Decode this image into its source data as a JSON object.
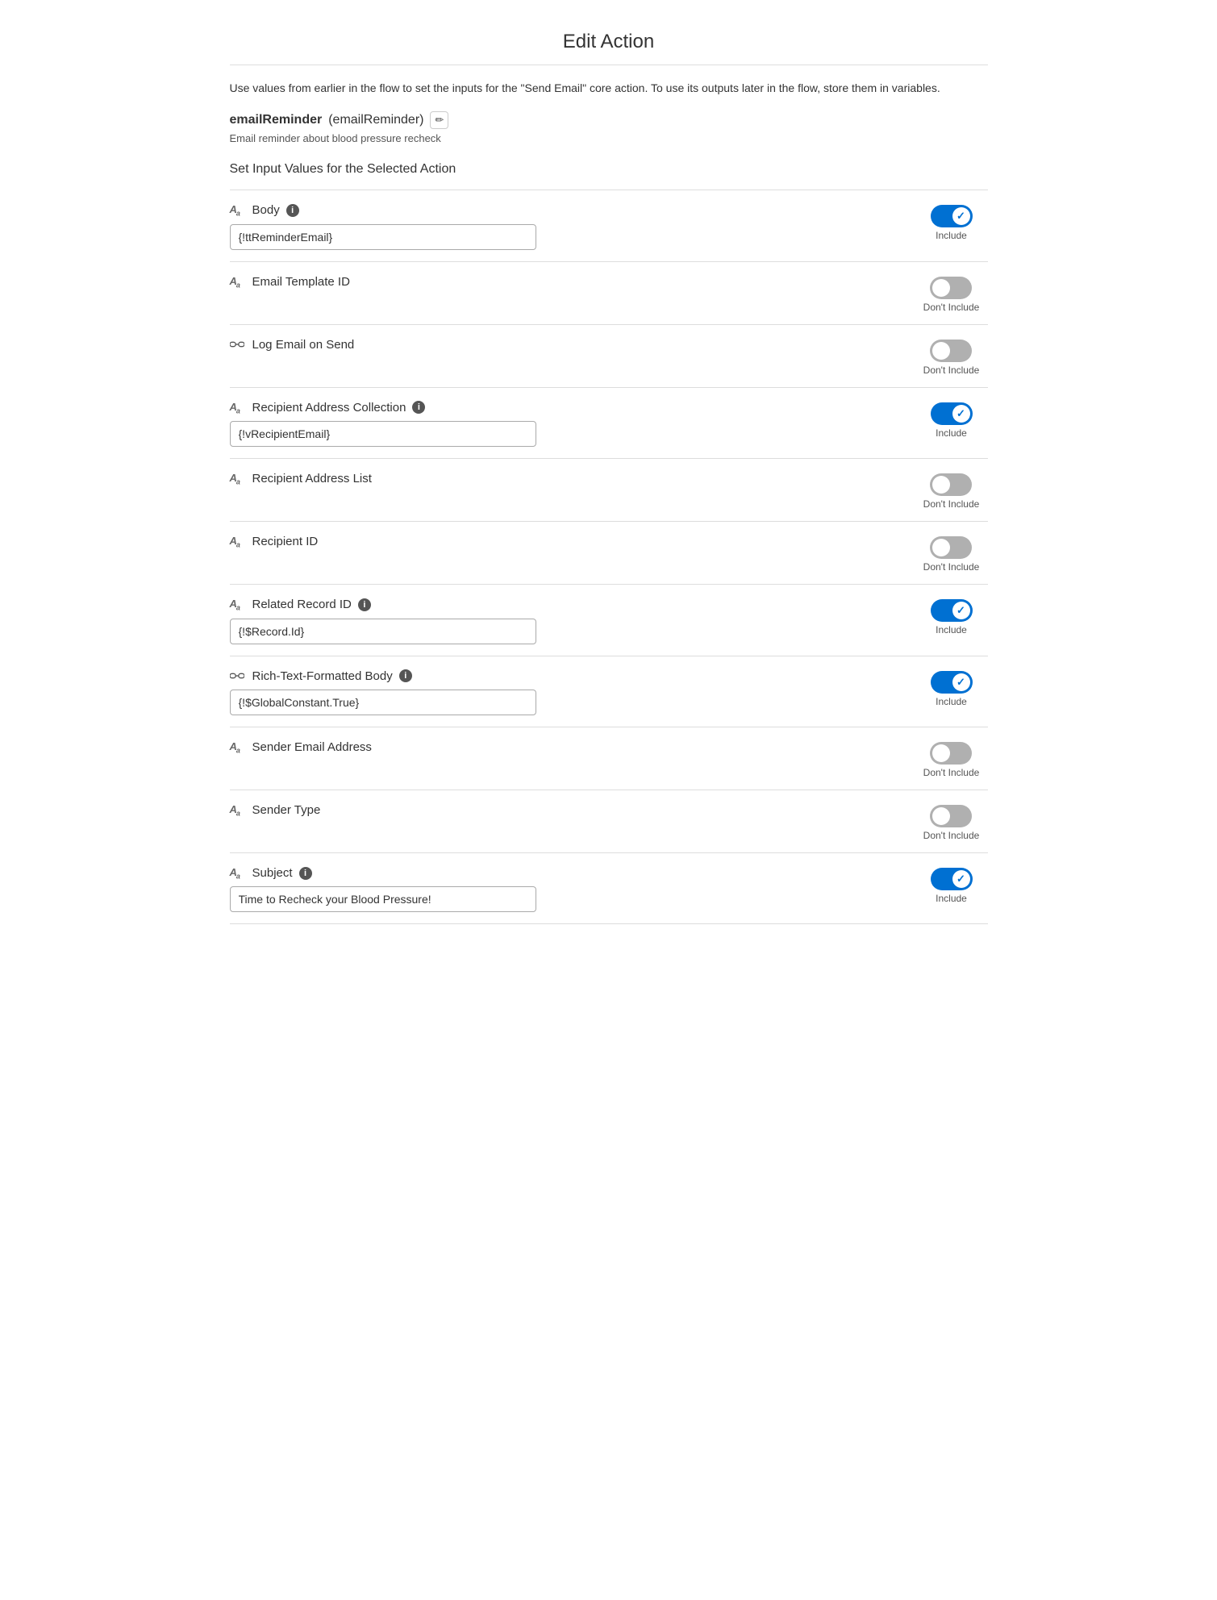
{
  "page": {
    "title": "Edit Action"
  },
  "description": {
    "text": "Use values from earlier in the flow to set the inputs for the \"Send Email\" core action. To use its outputs later in the flow, store them in variables."
  },
  "action": {
    "name": "emailReminder",
    "api_name": "(emailReminder)",
    "edit_label": "✏",
    "description": "Email reminder about blood pressure recheck"
  },
  "section_title": "Set Input Values for the Selected Action",
  "fields": [
    {
      "id": "body",
      "icon_type": "text",
      "icon_display": "Aa",
      "label": "Body",
      "has_info": true,
      "has_input": true,
      "input_value": "{!ttReminderEmail}",
      "toggle_on": true,
      "toggle_text_on": "Include",
      "toggle_text_off": "Don't Include"
    },
    {
      "id": "email-template-id",
      "icon_type": "text",
      "icon_display": "Aa",
      "label": "Email Template ID",
      "has_info": false,
      "has_input": false,
      "input_value": "",
      "toggle_on": false,
      "toggle_text_on": "Include",
      "toggle_text_off": "Don't Include"
    },
    {
      "id": "log-email-on-send",
      "icon_type": "link",
      "icon_display": "⊕",
      "label": "Log Email on Send",
      "has_info": false,
      "has_input": false,
      "input_value": "",
      "toggle_on": false,
      "toggle_text_on": "Include",
      "toggle_text_off": "Don't Include"
    },
    {
      "id": "recipient-address-collection",
      "icon_type": "text",
      "icon_display": "Aa",
      "label": "Recipient Address Collection",
      "has_info": true,
      "has_input": true,
      "input_value": "{!vRecipientEmail}",
      "toggle_on": true,
      "toggle_text_on": "Include",
      "toggle_text_off": "Don't Include"
    },
    {
      "id": "recipient-address-list",
      "icon_type": "text",
      "icon_display": "Aa",
      "label": "Recipient Address List",
      "has_info": false,
      "has_input": false,
      "input_value": "",
      "toggle_on": false,
      "toggle_text_on": "Include",
      "toggle_text_off": "Don't Include"
    },
    {
      "id": "recipient-id",
      "icon_type": "text",
      "icon_display": "Aa",
      "label": "Recipient ID",
      "has_info": false,
      "has_input": false,
      "input_value": "",
      "toggle_on": false,
      "toggle_text_on": "Include",
      "toggle_text_off": "Don't Include"
    },
    {
      "id": "related-record-id",
      "icon_type": "text",
      "icon_display": "Aa",
      "label": "Related Record ID",
      "has_info": true,
      "has_input": true,
      "input_value": "{!$Record.Id}",
      "toggle_on": true,
      "toggle_text_on": "Include",
      "toggle_text_off": "Don't Include"
    },
    {
      "id": "rich-text-formatted-body",
      "icon_type": "link",
      "icon_display": "⊕",
      "label": "Rich-Text-Formatted Body",
      "has_info": true,
      "has_input": true,
      "input_value": "{!$GlobalConstant.True}",
      "toggle_on": true,
      "toggle_text_on": "Include",
      "toggle_text_off": "Don't Include"
    },
    {
      "id": "sender-email-address",
      "icon_type": "text",
      "icon_display": "Aa",
      "label": "Sender Email Address",
      "has_info": false,
      "has_input": false,
      "input_value": "",
      "toggle_on": false,
      "toggle_text_on": "Include",
      "toggle_text_off": "Don't Include"
    },
    {
      "id": "sender-type",
      "icon_type": "text",
      "icon_display": "Aa",
      "label": "Sender Type",
      "has_info": false,
      "has_input": false,
      "input_value": "",
      "toggle_on": false,
      "toggle_text_on": "Include",
      "toggle_text_off": "Don't Include"
    },
    {
      "id": "subject",
      "icon_type": "text",
      "icon_display": "Aa",
      "label": "Subject",
      "has_info": true,
      "has_input": true,
      "input_value": "Time to Recheck your Blood Pressure!",
      "toggle_on": true,
      "toggle_text_on": "Include",
      "toggle_text_off": "Don't Include"
    }
  ]
}
